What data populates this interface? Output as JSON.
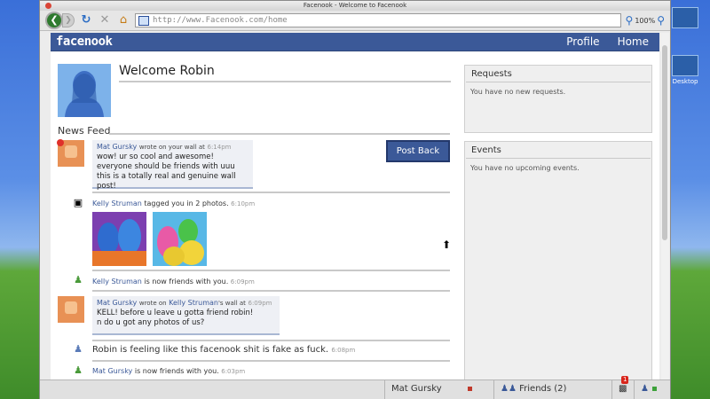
{
  "desktop": {
    "icon1_label": "",
    "icon2_label": "Desktop"
  },
  "window": {
    "title": "Facenook - Welcome to Facenook"
  },
  "browser": {
    "url": "http://www.Facenook.com/home",
    "zoom": "100%"
  },
  "header": {
    "logo": "facenook",
    "nav": [
      "Profile",
      "Home"
    ]
  },
  "profile": {
    "welcome": "Welcome Robin"
  },
  "feed": {
    "title": "News Feed",
    "post_back_label": "Post Back",
    "post1": {
      "author": "Mat Gursky",
      "action": "wrote on your wall at",
      "time": "6:14pm",
      "lines": [
        "wow! ur so cool and awesome!",
        "everyone should be friends with uuu",
        "this is a totally real and genuine wall post!"
      ]
    },
    "tag": {
      "author": "Kelly Struman",
      "action": "tagged you in 2 photos.",
      "time": "6:10pm"
    },
    "friend1": {
      "author": "Kelly Struman",
      "action": "is now friends with you.",
      "time": "6:09pm"
    },
    "post2": {
      "author": "Mat Gursky",
      "wrote": "wrote on",
      "target": "Kelly Struman",
      "suffix": "'s wall at",
      "time": "6:09pm",
      "lines": [
        "KELL! before u leave u gotta friend robin!",
        "n do u got any photos of us?"
      ]
    },
    "status": {
      "text": "Robin is feeling like this facenook shit is fake as fuck.",
      "time": "6:08pm"
    },
    "friend2": {
      "author": "Mat Gursky",
      "action": "is now friends with you.",
      "time": "6:03pm"
    }
  },
  "sidebar": {
    "requests": {
      "title": "Requests",
      "text": "You have no new requests."
    },
    "events": {
      "title": "Events",
      "text": "You have no upcoming events."
    }
  },
  "chat": {
    "contact": "Mat Gursky",
    "friends_label": "Friends (2)",
    "notification_count": "1"
  },
  "colors": {
    "brand": "#3b5998",
    "wall_box": "#eef0f5"
  }
}
